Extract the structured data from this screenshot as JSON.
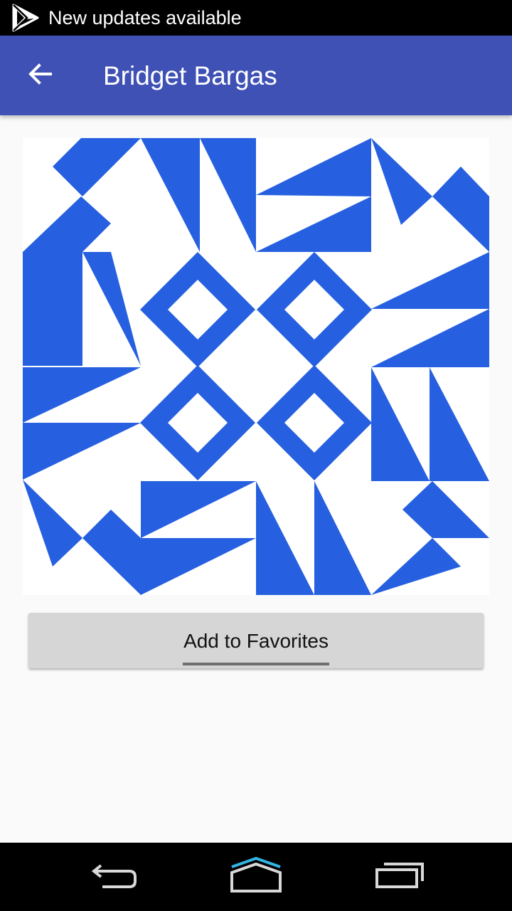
{
  "status_bar": {
    "notification_icon": "play-store-icon",
    "notification_text": "New updates available"
  },
  "app_bar": {
    "back_icon": "arrow-back-icon",
    "title": "Bridget Bargas",
    "background_color": "#3f51b5"
  },
  "avatar": {
    "icon": "identicon-avatar",
    "color": "#2660e0"
  },
  "favorites_button": {
    "label": "Add to Favorites"
  },
  "nav_bar": {
    "back_icon": "nav-back-icon",
    "home_icon": "nav-home-icon",
    "recents_icon": "nav-recents-icon"
  }
}
